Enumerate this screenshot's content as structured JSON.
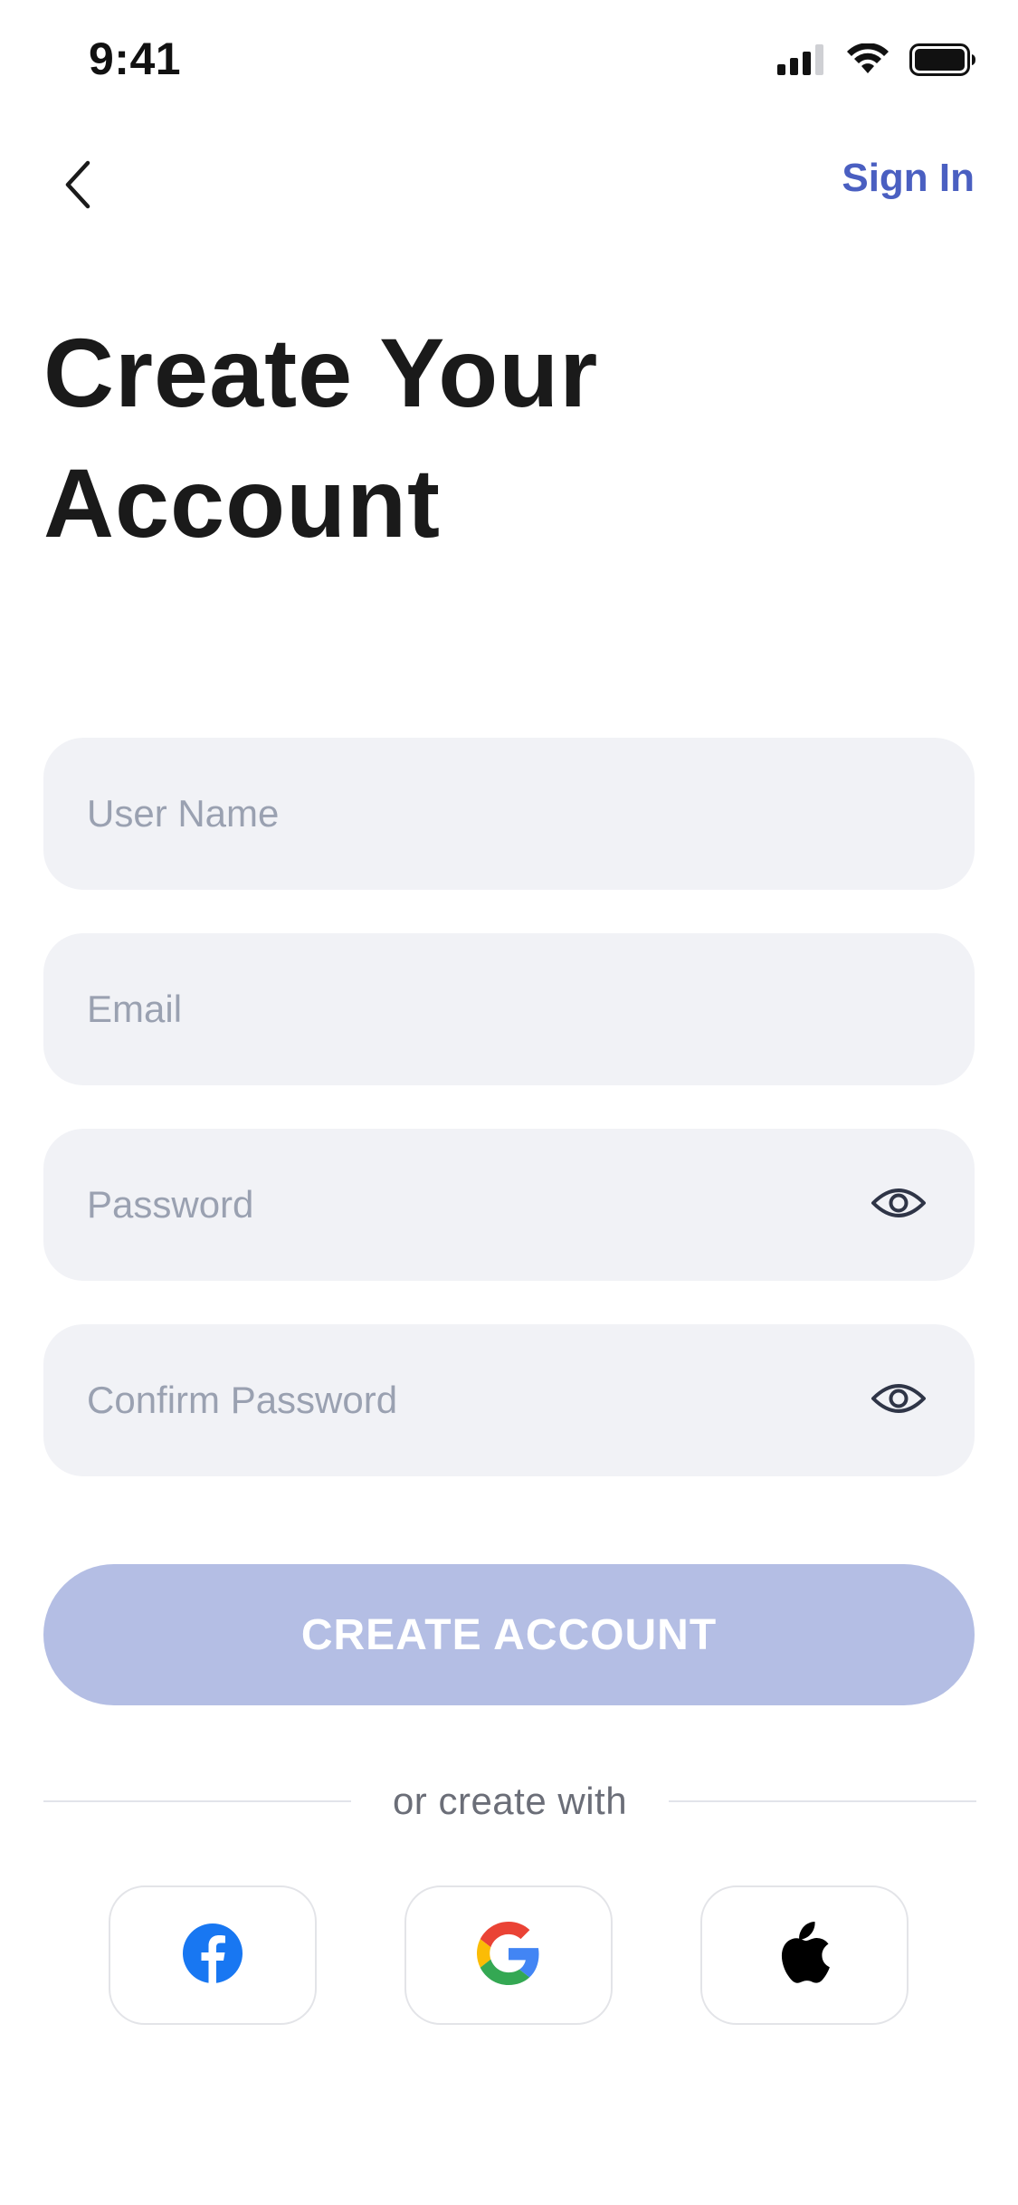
{
  "status_bar": {
    "time": "9:41",
    "icons": [
      "cellular-signal-icon",
      "wifi-icon",
      "battery-icon"
    ]
  },
  "nav": {
    "back_icon": "chevron-left-icon",
    "sign_in_label": "Sign In"
  },
  "title": {
    "line1": "Create Your",
    "line2": "Account"
  },
  "form": {
    "username": {
      "placeholder": "User Name",
      "value": ""
    },
    "email": {
      "placeholder": "Email",
      "value": ""
    },
    "password": {
      "placeholder": "Password",
      "value": "",
      "toggle_icon": "eye-icon"
    },
    "confirm_password": {
      "placeholder": "Confirm Password",
      "value": "",
      "toggle_icon": "eye-icon"
    }
  },
  "create_button": {
    "label": "CREATE ACCOUNT",
    "state": "disabled"
  },
  "divider_text": "or create with",
  "social": [
    {
      "name": "Facebook",
      "icon": "facebook-icon"
    },
    {
      "name": "Google",
      "icon": "google-icon"
    },
    {
      "name": "Apple",
      "icon": "apple-icon"
    }
  ],
  "colors": {
    "accent": "#4a5fc1",
    "button_disabled": "#b4bee4",
    "field_bg": "#f1f2f6",
    "placeholder": "#9aa1b1",
    "facebook": "#1877f2"
  }
}
